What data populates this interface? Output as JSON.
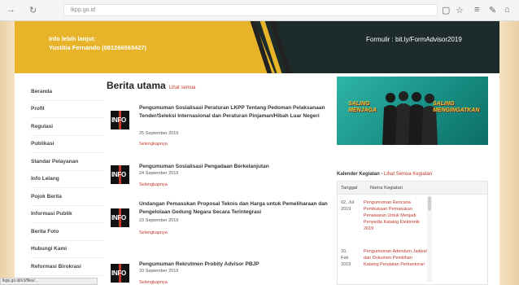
{
  "browser": {
    "url": "lkpp.go.id",
    "back_icon": "arrow-left",
    "reload_icon": "reload"
  },
  "banner": {
    "info_line1": "Info lebih lanjut:",
    "info_line2": "Yustitia Fernando (081266563427)",
    "formulir": "Formulir : bit.ly/FormAdvisor2019",
    "colors": {
      "yellow": "#e7b329",
      "dark": "#1d2b2b"
    }
  },
  "sidebar": {
    "items": [
      {
        "label": "Beranda"
      },
      {
        "label": "Profil"
      },
      {
        "label": "Regulasi"
      },
      {
        "label": "Publikasi"
      },
      {
        "label": "Standar Pelayanan"
      },
      {
        "label": "Info Lelang"
      },
      {
        "label": "Pojok Berita"
      },
      {
        "label": "Informasi Publik"
      },
      {
        "label": "Berita Foto"
      },
      {
        "label": "Hubungi Kami"
      },
      {
        "label": "Reformasi Birokrasi"
      }
    ]
  },
  "berita": {
    "title": "Berita utama",
    "lihat_semua": "Lihat semua",
    "thumb_label": "INFO",
    "more_label": "Selengkapnya",
    "items": [
      {
        "title": "Pengumuman Sosialisasi Peraturan LKPP Tentang Pedoman Pelaksanaan Tender/Seleksi Internasional dan Peraturan Pinjaman/Hibah Luar Negeri",
        "date": "25 September 2019"
      },
      {
        "title": "Pengumuman Sosialisasi Pengadaan Berkelanjutan",
        "date": "24 September 2019"
      },
      {
        "title": "Undangan Pemasukan Proposal Teknis dan Harga untuk Pemeliharaan dan Pengelolaan Gedung Negara Secara Terintegrasi",
        "date": "23 September 2019"
      },
      {
        "title": "Pengumuman Rekrutmen Probity Advisor PBJP",
        "date": "20 September 2019"
      }
    ]
  },
  "promo": {
    "left_text_1": "SALING",
    "left_text_2": "MENJAGA",
    "right_text_1": "SALING",
    "right_text_2": "MENGINGATKAN"
  },
  "kalender": {
    "title": "Kalender Kegiatan",
    "link": "Lihat Semua Kegiatan",
    "col_date": "Tanggal",
    "col_name": "Nama Kegiatan",
    "rows": [
      {
        "day": "02, Jul",
        "year": "2019",
        "name": "Pengumuman Rencana Pembukaan Pemasukan Penawaran Untuk Menjadi Penyedia Katalog Elektronik 2019"
      },
      {
        "day": "20,",
        "month": "Feb",
        "year": "2019",
        "name": "Pengumuman Adendum Jadwal dan Dokumen Pemilihan Katalog Peralatan Perkantoran"
      }
    ]
  },
  "statusbar": {
    "text": "lkpp.go.id/v3/files/..."
  }
}
